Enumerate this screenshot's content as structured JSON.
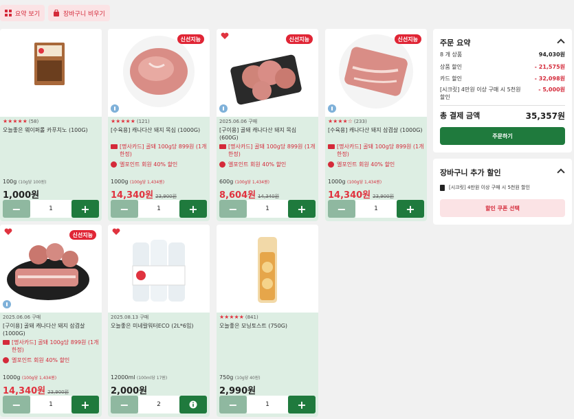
{
  "toolbar": {
    "summary_label": "요약 보기",
    "clear_cart_label": "장바구니 비우기"
  },
  "products": [
    {
      "stars": "★★★★★",
      "reviews": "(58)",
      "name": "오늘좋은 웨이퍼롤 카푸치노 (100G)",
      "unit": "100g",
      "unit_sub": "(10g당 100원)",
      "price": "1,000원",
      "qty": "1"
    },
    {
      "badge": "신선지능",
      "stars": "★★★★★",
      "reviews": "(121)",
      "name": "[수육용] 캐나다산 돼지 목심 (1000G)",
      "promo1": "[명사카드] 골돼 100g당 899원 (1개 한정)",
      "promo2": "엘포인트 회원 40% 할인",
      "unit": "1000g",
      "unit_sub": "(100g당 1,434원)",
      "price": "14,340원",
      "orig_price": "23,900원",
      "qty": "1"
    },
    {
      "badge": "신선지능",
      "date": "2025.06.06 구매",
      "name": "[구이용] 골돼 캐나다산 돼지 목심 (600G)",
      "promo1": "[명사카드] 골돼 100g당 899원 (1개 한정)",
      "promo2": "엘포인트 회원 40% 할인",
      "unit": "600g",
      "unit_sub": "(100g당 1,434원)",
      "price": "8,604원",
      "orig_price": "14,340원",
      "qty": "1"
    },
    {
      "badge": "신선지능",
      "stars": "★★★★☆",
      "reviews": "(233)",
      "name": "[수육용] 캐나다산 돼지 삼겹살 (1000G)",
      "promo1": "[명사카드] 골돼 100g당 899원 (1개 한정)",
      "promo2": "엘포인트 회원 40% 할인",
      "unit": "1000g",
      "unit_sub": "(100g당 1,434원)",
      "price": "14,340원",
      "orig_price": "23,900원",
      "qty": "1"
    },
    {
      "badge": "신선지능",
      "date": "2025.06.06 구매",
      "name": "[구이용] 골돼 캐나다산 돼지 삼겹살 (1000G)",
      "promo1": "[명사카드] 골돼 100g당 899원 (1개 한정)",
      "promo2": "엘포인트 회원 40% 할인",
      "unit": "1000g",
      "unit_sub": "(100g당 1,434원)",
      "price": "14,340원",
      "orig_price": "23,900원",
      "qty": "1"
    },
    {
      "date": "2025.08.13 구매",
      "name": "오늘좋은 미네랄워터ECO (2L*6입)",
      "unit": "12000ml",
      "unit_sub": "(100ml당 17원)",
      "price": "2,000원",
      "qty": "2"
    },
    {
      "stars": "★★★★★",
      "reviews": "(841)",
      "name": "오늘좋은 모닝토스트 (750G)",
      "unit": "750g",
      "unit_sub": "(10g당 40원)",
      "price": "2,990원",
      "qty": "1"
    }
  ],
  "summary": {
    "title": "주문 요약",
    "rows": [
      {
        "k": "8 개 상품",
        "v": "94,030원"
      },
      {
        "k": "상품 할인",
        "v": "- 21,575원"
      },
      {
        "k": "카드 할인",
        "v": "- 32,098원"
      },
      {
        "k": "[시크릿] 4만원 이상 구매 시 5천원 할인",
        "v": "- 5,000원"
      }
    ],
    "total_label": "총 결제 금액",
    "total_value": "35,357원",
    "order_button": "주문하기"
  },
  "extra": {
    "title": "장바구니 추가 할인",
    "coupon_text": "[시크릿] 4만원 이상 구매 시 5천원 할인",
    "coupon_button": "할인 쿠폰 선택"
  },
  "colors": {
    "accent_red": "#e0333f",
    "accent_green": "#1f7a3d",
    "soft_green": "#ddeee3"
  }
}
